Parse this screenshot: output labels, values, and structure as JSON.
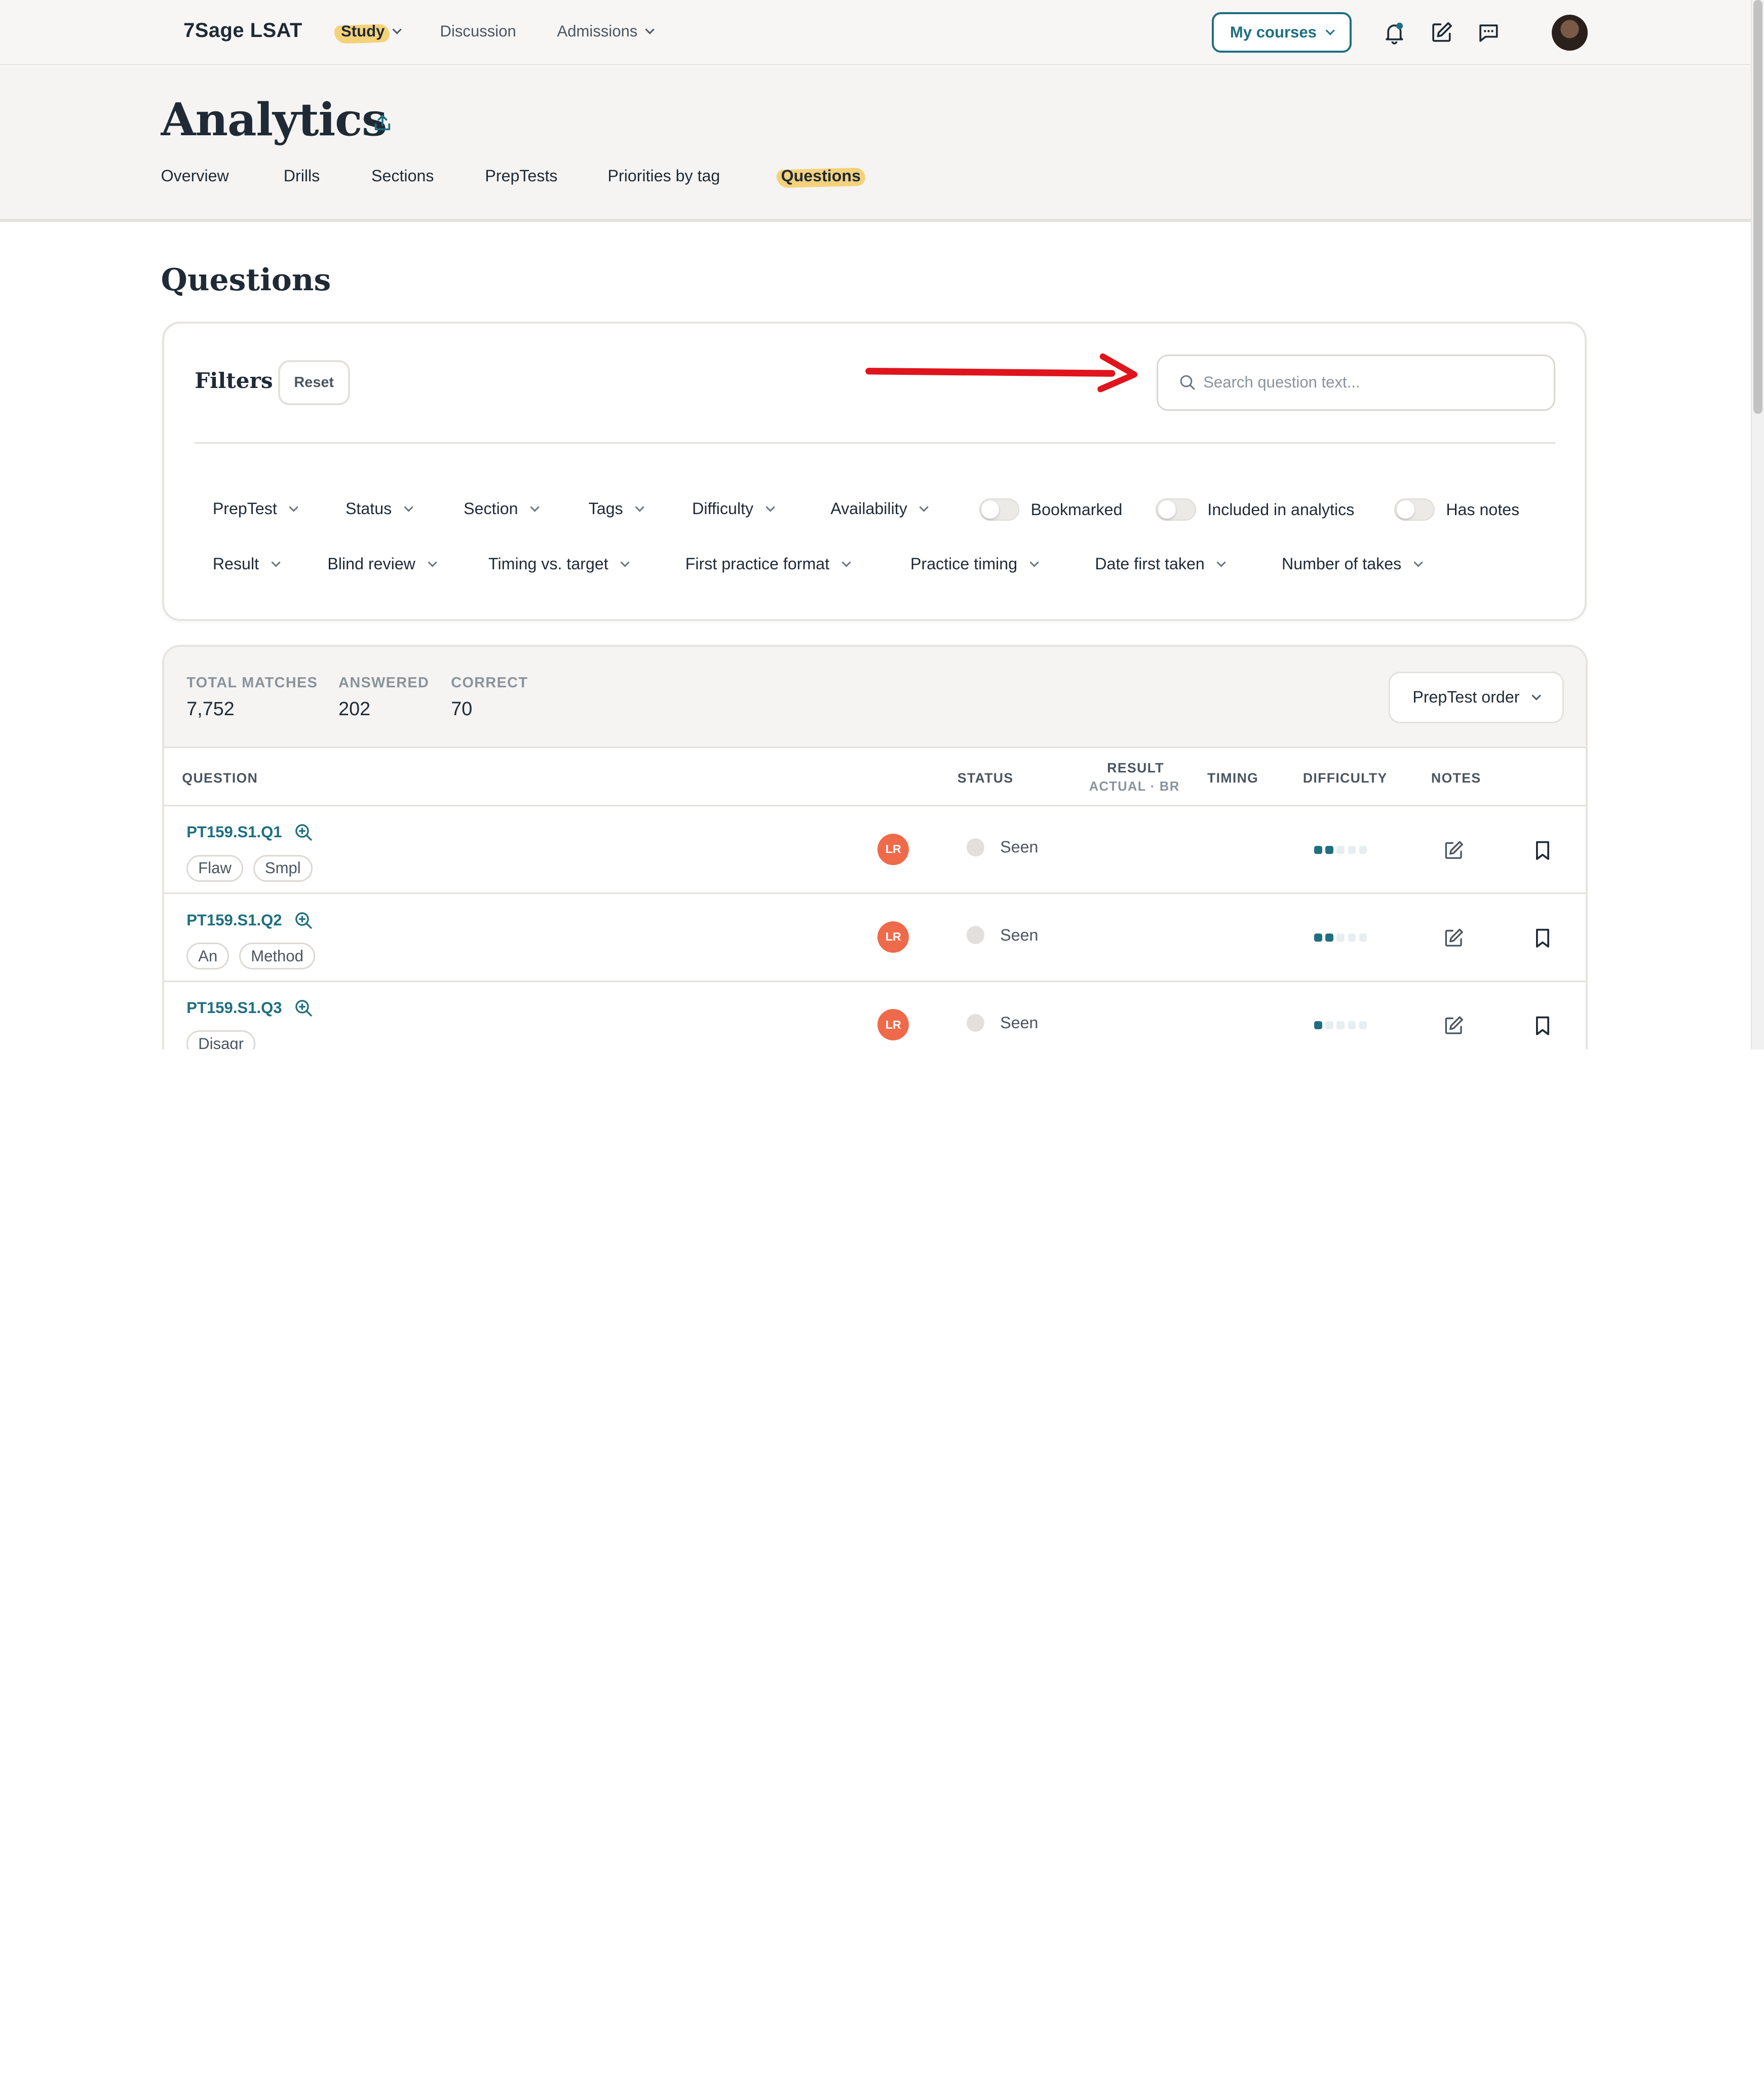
{
  "topnav": {
    "brand": "7Sage LSAT",
    "links": [
      {
        "label": "Study",
        "active": true,
        "dropdown": true
      },
      {
        "label": "Discussion",
        "active": false,
        "dropdown": false
      },
      {
        "label": "Admissions",
        "active": false,
        "dropdown": true
      }
    ],
    "my_courses": "My courses",
    "icons": [
      "bell-icon",
      "edit-icon",
      "chat-icon"
    ]
  },
  "header": {
    "title": "Analytics",
    "tabs": [
      "Overview",
      "Drills",
      "Sections",
      "PrepTests",
      "Priorities by tag",
      "Questions"
    ],
    "active_tab": "Questions"
  },
  "section_title": "Questions",
  "filters": {
    "title": "Filters",
    "reset": "Reset",
    "search_placeholder": "Search question text...",
    "row1": [
      "PrepTest",
      "Status",
      "Section",
      "Tags",
      "Difficulty",
      "Availability"
    ],
    "toggles": [
      "Bookmarked",
      "Included in analytics",
      "Has notes"
    ],
    "row2": [
      "Result",
      "Blind review",
      "Timing vs. target",
      "First practice format",
      "Practice timing",
      "Date first taken",
      "Number of takes"
    ]
  },
  "stats": {
    "total_label": "TOTAL MATCHES",
    "total_value": "7,752",
    "answered_label": "ANSWERED",
    "answered_value": "202",
    "correct_label": "CORRECT",
    "correct_value": "70",
    "order": "PrepTest order"
  },
  "table": {
    "headers": {
      "question": "QUESTION",
      "status": "STATUS",
      "result": "RESULT",
      "result_sub": "ACTUAL · BR",
      "timing": "TIMING",
      "difficulty": "DIFFICULTY",
      "notes": "NOTES"
    },
    "rows": [
      {
        "id": "PT159.S1.Q1",
        "tags": [
          "Flaw",
          "Smpl"
        ],
        "section": "LR",
        "status": "Seen",
        "difficulty": 2
      },
      {
        "id": "PT159.S1.Q2",
        "tags": [
          "An",
          "Method"
        ],
        "section": "LR",
        "status": "Seen",
        "difficulty": 2
      },
      {
        "id": "PT159.S1.Q3",
        "tags": [
          "Disagr"
        ],
        "section": "LR",
        "status": "Seen",
        "difficulty": 1
      }
    ],
    "difficulty_max": 5
  },
  "colors": {
    "accent": "#1f6f80",
    "highlight": "#f5d27a",
    "lr_badge": "#ef6a4a",
    "annotation_arrow": "#e0141c"
  }
}
